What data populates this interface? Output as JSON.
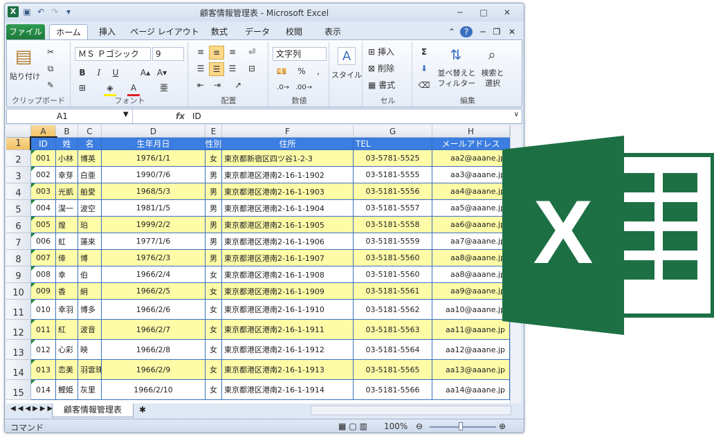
{
  "window": {
    "title": "顧客情報管理表 - Microsoft Excel"
  },
  "tabs": [
    "ファイル",
    "ホーム",
    "挿入",
    "ページ レイアウト",
    "数式",
    "データ",
    "校閲",
    "表示"
  ],
  "ribbon": {
    "clipboard": {
      "label": "クリップボード",
      "paste": "貼り付け"
    },
    "font": {
      "label": "フォント",
      "name": "ＭＳ Ｐゴシック",
      "size": "9"
    },
    "alignment": {
      "label": "配置"
    },
    "number": {
      "label": "数値",
      "format": "文字列"
    },
    "styles": {
      "label": "スタイル"
    },
    "cells": {
      "label": "セル",
      "insert": "挿入",
      "delete": "削除",
      "format": "書式"
    },
    "editing": {
      "label": "編集",
      "sort": "並べ替えと",
      "filter": "フィルター",
      "find": "検索と",
      "select": "選択"
    }
  },
  "formula_bar": {
    "name_box": "A1",
    "fx": "fx",
    "value": "ID"
  },
  "columns": [
    "A",
    "B",
    "C",
    "D",
    "E",
    "F",
    "G",
    "H"
  ],
  "header": [
    "ID",
    "姓",
    "名",
    "生年月日",
    "性別",
    "住所",
    "TEL",
    "メールアドレス"
  ],
  "rows": [
    {
      "n": "2",
      "cells": [
        "001",
        "小林",
        "博英",
        "1976/1/1",
        "女",
        "東京都新宿区四ツ谷1-2-3",
        "03-5781-5525",
        "aa2@aaane.jp"
      ]
    },
    {
      "n": "3",
      "cells": [
        "002",
        "幸芽",
        "白亜",
        "1990/7/6",
        "男",
        "東京都港区港南2-16-1-1902",
        "03-5181-5555",
        "aa3@aaane.jp"
      ]
    },
    {
      "n": "4",
      "cells": [
        "003",
        "光凱",
        "舶愛",
        "1968/5/3",
        "男",
        "東京都港区港南2-16-1-1903",
        "03-5181-5556",
        "aa4@aaane.jp"
      ]
    },
    {
      "n": "5",
      "cells": [
        "004",
        "淏一",
        "波空",
        "1981/1/5",
        "男",
        "東京都港区港南2-16-1-1904",
        "03-5181-5557",
        "aa5@aaane.jp"
      ]
    },
    {
      "n": "6",
      "cells": [
        "005",
        "煌",
        "珀",
        "1999/2/2",
        "男",
        "東京都港区港南2-16-1-1905",
        "03-5181-5558",
        "aa6@aaane.jp"
      ]
    },
    {
      "n": "7",
      "cells": [
        "006",
        "虹",
        "蓮來",
        "1977/1/6",
        "男",
        "東京都港区港南2-16-1-1906",
        "03-5181-5559",
        "aa7@aaane.jp"
      ]
    },
    {
      "n": "8",
      "cells": [
        "007",
        "倖",
        "博",
        "1976/2/3",
        "男",
        "東京都港区港南2-16-1-1907",
        "03-5181-5560",
        "aa8@aaane.jp"
      ]
    },
    {
      "n": "9",
      "cells": [
        "008",
        "幸",
        "伯",
        "1966/2/4",
        "女",
        "東京都港区港南2-16-1-1908",
        "03-5181-5560",
        "aa8@aaane.jp"
      ]
    },
    {
      "n": "10",
      "cells": [
        "009",
        "香",
        "絅",
        "1966/2/5",
        "女",
        "東京都港区港南2-16-1-1909",
        "03-5181-5561",
        "aa9@aaane.jp"
      ]
    },
    {
      "n": "11",
      "cells": [
        "010",
        "幸羽",
        "博多",
        "1966/2/6",
        "女",
        "東京都港区港南2-16-1-1910",
        "03-5181-5562",
        "aa10@aaane.jp"
      ]
    },
    {
      "n": "12",
      "cells": [
        "011",
        "紅",
        "波音",
        "1966/2/7",
        "女",
        "東京都港区港南2-16-1-1911",
        "03-5181-5563",
        "aa11@aaane.jp"
      ]
    },
    {
      "n": "13",
      "cells": [
        "012",
        "心彩",
        "映",
        "1966/2/8",
        "女",
        "東京都港区港南2-16-1-1912",
        "03-5181-5564",
        "aa12@aaane.jp"
      ]
    },
    {
      "n": "14",
      "cells": [
        "013",
        "恋美",
        "羽雲珠",
        "1966/2/9",
        "女",
        "東京都港区港南2-16-1-1913",
        "03-5181-5565",
        "aa13@aaane.jp"
      ]
    },
    {
      "n": "15",
      "cells": [
        "014",
        "鯉姫",
        "灰里",
        "1966/2/10",
        "女",
        "東京都港区港南2-16-1-1914",
        "03-5181-5566",
        "aa14@aaane.jp"
      ]
    }
  ],
  "row1": "1",
  "sheet_tab": "顧客情報管理表",
  "status": {
    "mode": "コマンド",
    "zoom": "100%"
  },
  "colors": {
    "header": "#3b7de0",
    "yellow": "#fffca8",
    "border": "#3c6fc2",
    "excel_green": "#1d7044"
  },
  "logo": {
    "letter": "X"
  }
}
